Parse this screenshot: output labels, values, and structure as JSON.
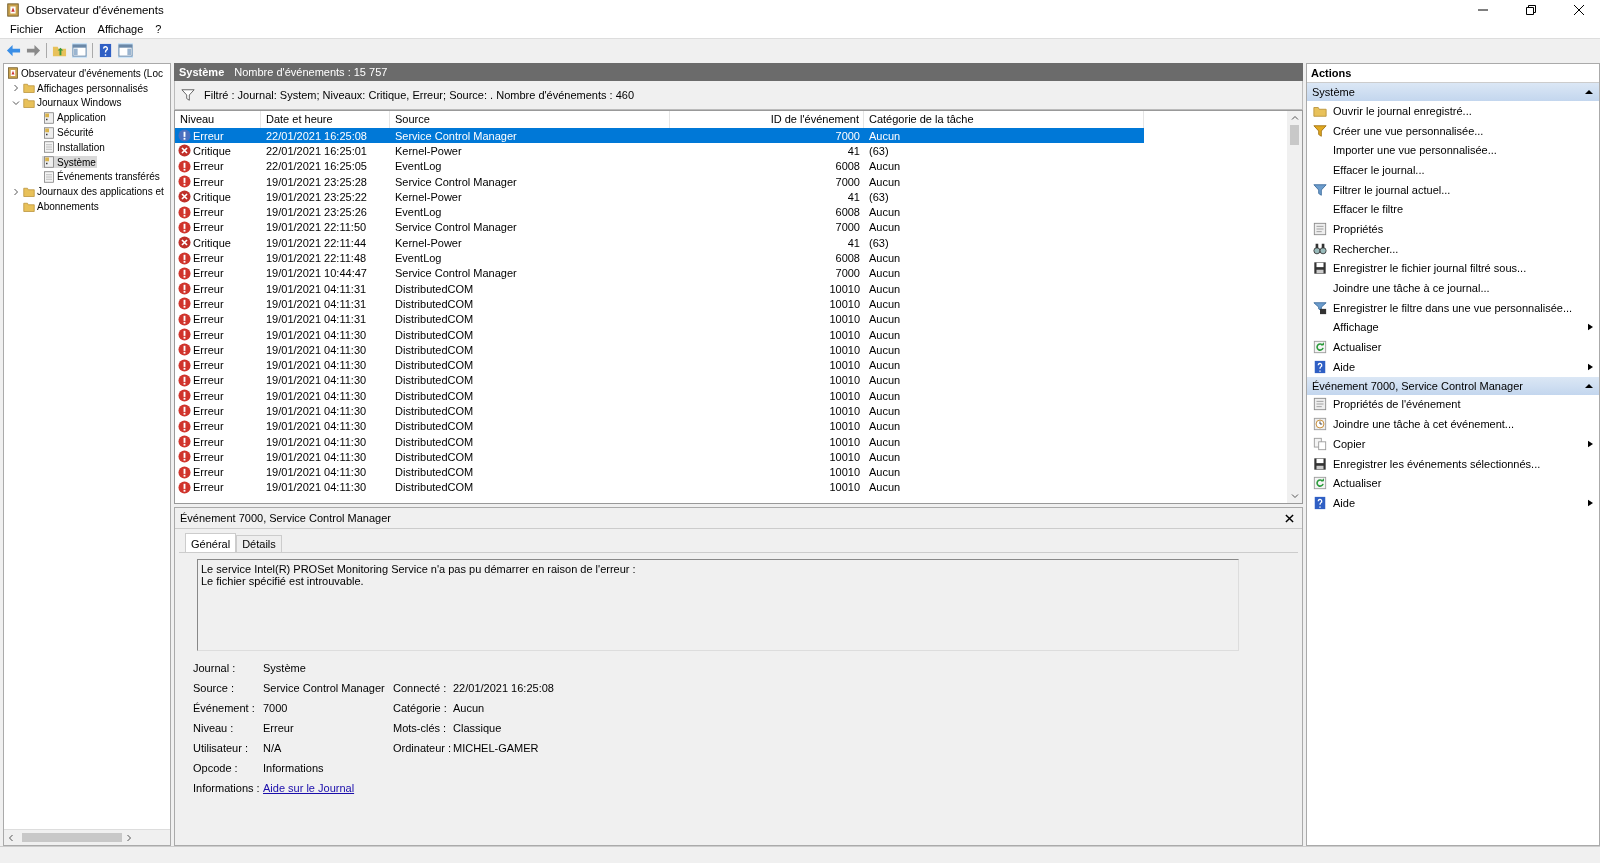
{
  "window": {
    "title": "Observateur d'événements"
  },
  "menu": [
    "Fichier",
    "Action",
    "Affichage",
    "?"
  ],
  "tree": [
    {
      "label": "Observateur d'événements (Loc",
      "kind": "viewer",
      "selected": false,
      "children": [
        {
          "label": "Affichages personnalisés",
          "kind": "folder",
          "selected": false,
          "expanded": false
        },
        {
          "label": "Journaux Windows",
          "kind": "folder",
          "selected": false,
          "expanded": true,
          "children": [
            {
              "label": "Application",
              "kind": "log",
              "selected": false
            },
            {
              "label": "Sécurité",
              "kind": "log",
              "selected": false
            },
            {
              "label": "Installation",
              "kind": "log-plain",
              "selected": false
            },
            {
              "label": "Système",
              "kind": "log",
              "selected": true
            },
            {
              "label": "Événements transférés",
              "kind": "log-plain",
              "selected": false
            }
          ]
        },
        {
          "label": "Journaux des applications et",
          "kind": "folder",
          "selected": false,
          "expanded": false
        },
        {
          "label": "Abonnements",
          "kind": "folder",
          "selected": false
        }
      ]
    }
  ],
  "log_header": {
    "title": "Système",
    "count": "Nombre d'événements : 15 757"
  },
  "filter": "Filtré : Journal: System; Niveaux: Critique, Erreur; Source: . Nombre d'événements : 460",
  "columns": [
    "Niveau",
    "Date et heure",
    "Source",
    "ID de l'événement",
    "Catégorie de la tâche"
  ],
  "rows": [
    {
      "kind": "error",
      "level": "Erreur",
      "date": "22/01/2021 16:25:08",
      "source": "Service Control Manager",
      "id": "7000",
      "category": "Aucun",
      "selected": true
    },
    {
      "kind": "critical",
      "level": "Critique",
      "date": "22/01/2021 16:25:01",
      "source": "Kernel-Power",
      "id": "41",
      "category": "(63)",
      "selected": false
    },
    {
      "kind": "error",
      "level": "Erreur",
      "date": "22/01/2021 16:25:05",
      "source": "EventLog",
      "id": "6008",
      "category": "Aucun",
      "selected": false
    },
    {
      "kind": "error",
      "level": "Erreur",
      "date": "19/01/2021 23:25:28",
      "source": "Service Control Manager",
      "id": "7000",
      "category": "Aucun",
      "selected": false
    },
    {
      "kind": "critical",
      "level": "Critique",
      "date": "19/01/2021 23:25:22",
      "source": "Kernel-Power",
      "id": "41",
      "category": "(63)",
      "selected": false
    },
    {
      "kind": "error",
      "level": "Erreur",
      "date": "19/01/2021 23:25:26",
      "source": "EventLog",
      "id": "6008",
      "category": "Aucun",
      "selected": false
    },
    {
      "kind": "error",
      "level": "Erreur",
      "date": "19/01/2021 22:11:50",
      "source": "Service Control Manager",
      "id": "7000",
      "category": "Aucun",
      "selected": false
    },
    {
      "kind": "critical",
      "level": "Critique",
      "date": "19/01/2021 22:11:44",
      "source": "Kernel-Power",
      "id": "41",
      "category": "(63)",
      "selected": false
    },
    {
      "kind": "error",
      "level": "Erreur",
      "date": "19/01/2021 22:11:48",
      "source": "EventLog",
      "id": "6008",
      "category": "Aucun",
      "selected": false
    },
    {
      "kind": "error",
      "level": "Erreur",
      "date": "19/01/2021 10:44:47",
      "source": "Service Control Manager",
      "id": "7000",
      "category": "Aucun",
      "selected": false
    },
    {
      "kind": "error",
      "level": "Erreur",
      "date": "19/01/2021 04:11:31",
      "source": "DistributedCOM",
      "id": "10010",
      "category": "Aucun",
      "selected": false
    },
    {
      "kind": "error",
      "level": "Erreur",
      "date": "19/01/2021 04:11:31",
      "source": "DistributedCOM",
      "id": "10010",
      "category": "Aucun",
      "selected": false
    },
    {
      "kind": "error",
      "level": "Erreur",
      "date": "19/01/2021 04:11:31",
      "source": "DistributedCOM",
      "id": "10010",
      "category": "Aucun",
      "selected": false
    },
    {
      "kind": "error",
      "level": "Erreur",
      "date": "19/01/2021 04:11:30",
      "source": "DistributedCOM",
      "id": "10010",
      "category": "Aucun",
      "selected": false
    },
    {
      "kind": "error",
      "level": "Erreur",
      "date": "19/01/2021 04:11:30",
      "source": "DistributedCOM",
      "id": "10010",
      "category": "Aucun",
      "selected": false
    },
    {
      "kind": "error",
      "level": "Erreur",
      "date": "19/01/2021 04:11:30",
      "source": "DistributedCOM",
      "id": "10010",
      "category": "Aucun",
      "selected": false
    },
    {
      "kind": "error",
      "level": "Erreur",
      "date": "19/01/2021 04:11:30",
      "source": "DistributedCOM",
      "id": "10010",
      "category": "Aucun",
      "selected": false
    },
    {
      "kind": "error",
      "level": "Erreur",
      "date": "19/01/2021 04:11:30",
      "source": "DistributedCOM",
      "id": "10010",
      "category": "Aucun",
      "selected": false
    },
    {
      "kind": "error",
      "level": "Erreur",
      "date": "19/01/2021 04:11:30",
      "source": "DistributedCOM",
      "id": "10010",
      "category": "Aucun",
      "selected": false
    },
    {
      "kind": "error",
      "level": "Erreur",
      "date": "19/01/2021 04:11:30",
      "source": "DistributedCOM",
      "id": "10010",
      "category": "Aucun",
      "selected": false
    },
    {
      "kind": "error",
      "level": "Erreur",
      "date": "19/01/2021 04:11:30",
      "source": "DistributedCOM",
      "id": "10010",
      "category": "Aucun",
      "selected": false
    },
    {
      "kind": "error",
      "level": "Erreur",
      "date": "19/01/2021 04:11:30",
      "source": "DistributedCOM",
      "id": "10010",
      "category": "Aucun",
      "selected": false
    },
    {
      "kind": "error",
      "level": "Erreur",
      "date": "19/01/2021 04:11:30",
      "source": "DistributedCOM",
      "id": "10010",
      "category": "Aucun",
      "selected": false
    },
    {
      "kind": "error",
      "level": "Erreur",
      "date": "19/01/2021 04:11:30",
      "source": "DistributedCOM",
      "id": "10010",
      "category": "Aucun",
      "selected": false
    }
  ],
  "detail": {
    "title": "Événement 7000, Service Control Manager",
    "tabs": [
      {
        "label": "Général",
        "selected": true
      },
      {
        "label": "Détails",
        "selected": false
      }
    ],
    "message": [
      "Le service Intel(R) PROSet Monitoring Service n'a pas pu démarrer en raison de l'erreur :",
      "Le fichier spécifié est introuvable."
    ],
    "field_rows": [
      {
        "left": {
          "label": "Journal :",
          "value": "Système"
        }
      },
      {
        "left": {
          "label": "Source :",
          "value": "Service Control Manager"
        },
        "right": {
          "label": "Connecté :",
          "value": "22/01/2021 16:25:08"
        }
      },
      {
        "left": {
          "label": "Événement :",
          "value": "7000"
        },
        "right": {
          "label": "Catégorie :",
          "value": "Aucun"
        }
      },
      {
        "left": {
          "label": "Niveau :",
          "value": "Erreur"
        },
        "right": {
          "label": "Mots-clés :",
          "value": "Classique"
        }
      },
      {
        "left": {
          "label": "Utilisateur :",
          "value": "N/A"
        },
        "right": {
          "label": "Ordinateur :",
          "value": "MICHEL-GAMER"
        }
      },
      {
        "left": {
          "label": "Opcode :",
          "value": "Informations"
        }
      },
      {
        "left": {
          "label": "Informations :",
          "value": "Aide sur le Journal",
          "kind": "link"
        }
      }
    ]
  },
  "actions": {
    "title": "Actions",
    "sections": [
      {
        "title": "Système",
        "expanded": true,
        "items": [
          {
            "label": "Ouvrir le journal enregistré...",
            "kind": "folder",
            "submenu": false
          },
          {
            "label": "Créer une vue personnalisée...",
            "kind": "filter-new",
            "submenu": false
          },
          {
            "label": "Importer une vue personnalisée...",
            "kind": "none",
            "submenu": false
          },
          {
            "label": "Effacer le journal...",
            "kind": "none",
            "submenu": false
          },
          {
            "label": "Filtrer le journal actuel...",
            "kind": "filter",
            "submenu": false
          },
          {
            "label": "Effacer le filtre",
            "kind": "none",
            "submenu": false
          },
          {
            "label": "Propriétés",
            "kind": "properties",
            "submenu": false
          },
          {
            "label": "Rechercher...",
            "kind": "find",
            "submenu": false
          },
          {
            "label": "Enregistrer le fichier journal filtré sous...",
            "kind": "save",
            "submenu": false
          },
          {
            "label": "Joindre une tâche à ce journal...",
            "kind": "none",
            "submenu": false
          },
          {
            "label": "Enregistrer le filtre dans une vue personnalisée...",
            "kind": "save-filter",
            "submenu": false
          },
          {
            "label": "Affichage",
            "kind": "none",
            "submenu": true
          },
          {
            "label": "Actualiser",
            "kind": "refresh",
            "submenu": false
          },
          {
            "label": "Aide",
            "kind": "help",
            "submenu": true
          }
        ]
      },
      {
        "title": "Événement 7000, Service Control Manager",
        "expanded": true,
        "items": [
          {
            "label": "Propriétés de l'événement",
            "kind": "properties",
            "submenu": false
          },
          {
            "label": "Joindre une tâche à cet événement...",
            "kind": "task",
            "submenu": false
          },
          {
            "label": "Copier",
            "kind": "copy",
            "submenu": true
          },
          {
            "label": "Enregistrer les événements sélectionnés...",
            "kind": "save",
            "submenu": false
          },
          {
            "label": "Actualiser",
            "kind": "refresh",
            "submenu": false
          },
          {
            "label": "Aide",
            "kind": "help",
            "submenu": true
          }
        ]
      }
    ]
  }
}
